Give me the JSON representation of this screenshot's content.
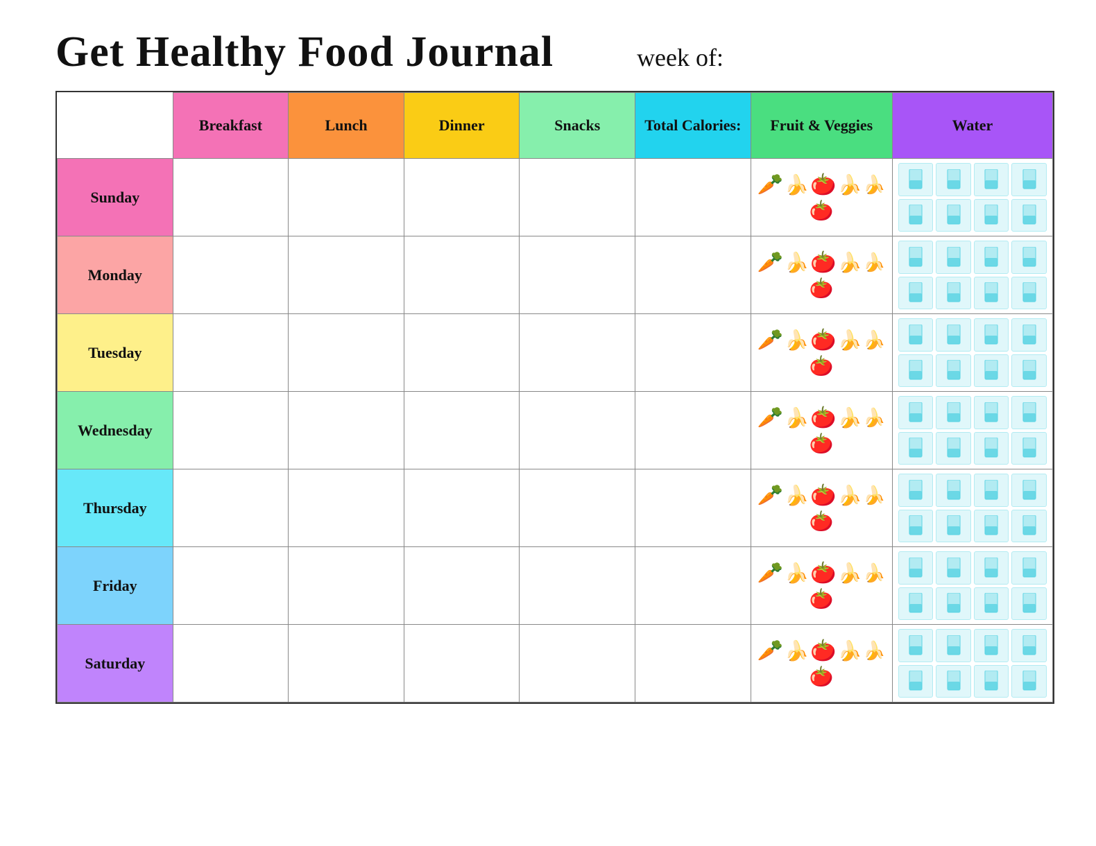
{
  "header": {
    "title": "Get Healthy Food Journal",
    "week_of_label": "week of:"
  },
  "columns": {
    "day": "",
    "breakfast": "Breakfast",
    "lunch": "Lunch",
    "dinner": "Dinner",
    "snacks": "Snacks",
    "calories": "Total Calories:",
    "fv": "Fruit & Veggies",
    "water": "Water"
  },
  "days": [
    {
      "name": "Sunday",
      "class": "day-sunday"
    },
    {
      "name": "Monday",
      "class": "day-monday"
    },
    {
      "name": "Tuesday",
      "class": "day-tuesday"
    },
    {
      "name": "Wednesday",
      "class": "day-wednesday"
    },
    {
      "name": "Thursday",
      "class": "day-thursday"
    },
    {
      "name": "Friday",
      "class": "day-friday"
    },
    {
      "name": "Saturday",
      "class": "day-saturday"
    }
  ]
}
